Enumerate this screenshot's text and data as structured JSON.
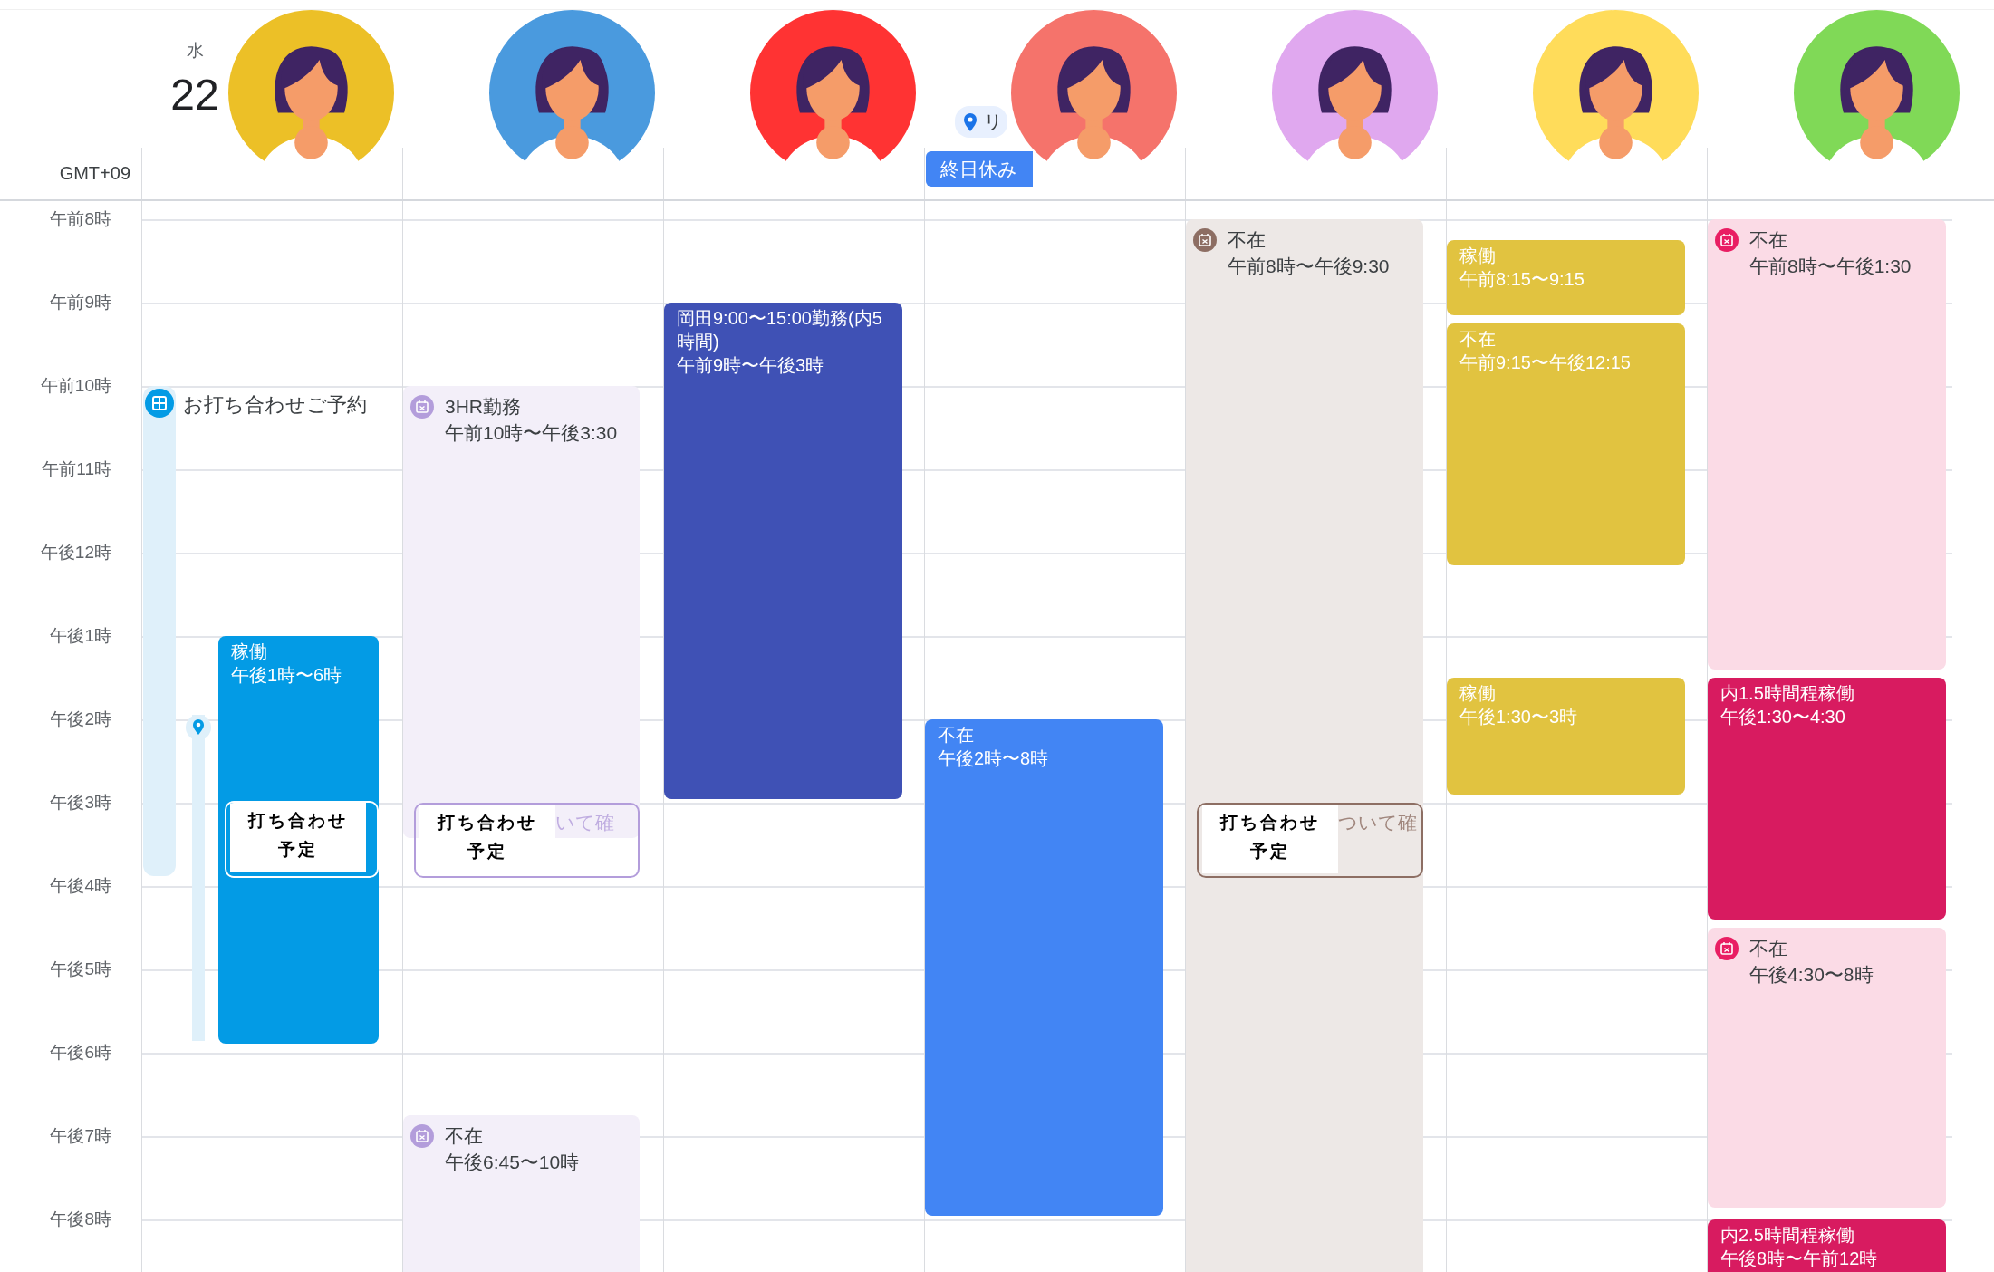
{
  "date": {
    "weekday": "水",
    "day": "22"
  },
  "timezone": "GMT+09",
  "hours": [
    "午前8時",
    "午前9時",
    "午前10時",
    "午前11時",
    "午後12時",
    "午後1時",
    "午後2時",
    "午後3時",
    "午後4時",
    "午後5時",
    "午後6時",
    "午後7時",
    "午後8時"
  ],
  "columns": [
    {
      "avatar": {
        "color": "#ecc027"
      },
      "events": [
        {
          "kind": "bar",
          "color": "#039be5",
          "title": "お打ち合わせご予約"
        },
        {
          "kind": "solid",
          "color": "#039be5",
          "title": "稼働",
          "time": "午後1時〜6時"
        },
        {
          "kind": "pin-bar",
          "color": "#039be5"
        },
        {
          "kind": "outline",
          "color": "#ffffff",
          "label": "打ち合わせ予定"
        }
      ]
    },
    {
      "avatar": {
        "color": "#4a9ade"
      },
      "events": [
        {
          "kind": "tinted",
          "color": "#b39ddb",
          "title": "3HR勤務",
          "time": "午前10時〜午後3:30"
        },
        {
          "kind": "outline",
          "color": "#b39ddb",
          "label": "打ち合わせ予定",
          "trailing": "いて確"
        },
        {
          "kind": "tinted",
          "color": "#b39ddb",
          "title": "不在",
          "time": "午後6:45〜10時"
        }
      ]
    },
    {
      "avatar": {
        "color": "#ff3333"
      },
      "events": [
        {
          "kind": "solid",
          "color": "#3f51b5",
          "title": "岡田9:00〜15:00勤務(内5時間)",
          "time": "午前9時〜午後3時"
        }
      ]
    },
    {
      "avatar": {
        "color": "#f5736b"
      },
      "location_chip": "リ",
      "all_day": [
        {
          "title": "終日休み",
          "color": "#4285f4"
        }
      ],
      "events": [
        {
          "kind": "solid",
          "color": "#4285f4",
          "title": "不在",
          "time": "午後2時〜8時"
        }
      ]
    },
    {
      "avatar": {
        "color": "#e0a8ef"
      },
      "events": [
        {
          "kind": "tinted",
          "color": "#8d6e63",
          "title": "不在",
          "time": "午前8時〜午後9:30"
        },
        {
          "kind": "outline",
          "color": "#8d6e63",
          "label": "打ち合わせ予定",
          "trailing": "ついて確"
        }
      ]
    },
    {
      "avatar": {
        "color": "#ffdc5a"
      },
      "events": [
        {
          "kind": "solid",
          "color": "#e1c340",
          "title": "稼働",
          "time": "午前8:15〜9:15"
        },
        {
          "kind": "solid",
          "color": "#e1c340",
          "title": "不在",
          "time": "午前9:15〜午後12:15"
        },
        {
          "kind": "solid",
          "color": "#e1c340",
          "title": "稼働",
          "time": "午後1:30〜3時"
        }
      ]
    },
    {
      "avatar": {
        "color": "#80d957"
      },
      "events": [
        {
          "kind": "tinted",
          "color": "#e91e63",
          "title": "不在",
          "time": "午前8時〜午後1:30"
        },
        {
          "kind": "solid",
          "color": "#d81b60",
          "title": "内1.5時間程稼働",
          "time": "午後1:30〜4:30"
        },
        {
          "kind": "tinted",
          "color": "#e91e63",
          "title": "不在",
          "time": "午後4:30〜8時"
        },
        {
          "kind": "solid",
          "color": "#d81b60",
          "title": "内2.5時間程稼働",
          "time": "午後8時〜午前12時"
        }
      ]
    }
  ]
}
